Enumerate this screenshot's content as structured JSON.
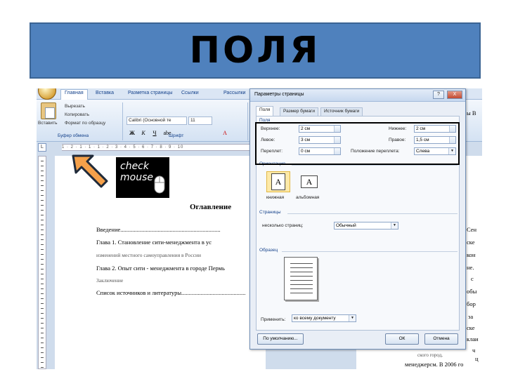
{
  "slide": {
    "title": "ПОЛЯ"
  },
  "word": {
    "ribbon_tabs": [
      "Главная",
      "Вставка",
      "Разметка страницы",
      "Ссылки",
      "Рассылки"
    ],
    "clipboard": {
      "paste_label": "Вставить",
      "cut": "Вырезать",
      "copy": "Копировать",
      "format_painter": "Формат по образцу",
      "group_label": "Буфер обмена"
    },
    "font": {
      "name": "Calibri (Основной те",
      "size": "11",
      "group_label": "Шрифт"
    },
    "ruler_text": "1 · 2 · 1 · 1 · 1 · 2 · 3 · 4 · 5 · 6 · 7 · 8 · 9 · 10",
    "ruler_tab_glyph": "L",
    "document": {
      "toc_title": "Оглавление",
      "lines": [
        "Введение...................................................................",
        "Глава 1. Становление сити-менеджмента в ус",
        "изменений местного самоуправления в России",
        "Глава 2. Опыт сити - менеджмента в городе Пермь",
        "Заключение",
        "Список источников и литературы..........................................."
      ],
      "right_fragments": [
        "ы В",
        "Сен",
        "ске",
        "кон",
        "не.",
        "с",
        "обы",
        "бор",
        "за",
        "ске",
        "кла",
        "ч",
        "ц",
        "и",
        "ского город,",
        "менеджерсм. В 2006 го"
      ]
    },
    "logo": {
      "line1": "check",
      "line2": "mouse"
    }
  },
  "dialog": {
    "title": "Параметры страницы",
    "title_buttons": {
      "help": "?",
      "close": "X"
    },
    "tabs": [
      "Поля",
      "Размер бумаги",
      "Источник бумаги"
    ],
    "margins_section": "Поля",
    "fields": {
      "top": {
        "label": "Верхнее:",
        "value": "2 см"
      },
      "bottom": {
        "label": "Нижнее:",
        "value": "2 см"
      },
      "left": {
        "label": "Левое:",
        "value": "3 см"
      },
      "right": {
        "label": "Правое:",
        "value": "1,5 см"
      },
      "gutter": {
        "label": "Переплет:",
        "value": "0 см"
      },
      "gutter_pos": {
        "label": "Положение переплета:",
        "value": "Слева"
      }
    },
    "orientation_section": "Ориентация",
    "orientation": {
      "portrait": "книжная",
      "landscape": "альбомная"
    },
    "pages_section": "Страницы",
    "pages": {
      "label": "несколько страниц:",
      "value": "Обычный"
    },
    "sample_section": "Образец",
    "apply": {
      "label": "Применить:",
      "value": "ко всему документу"
    },
    "buttons": {
      "default": "По умолчанию...",
      "ok": "ОК",
      "cancel": "Отмена"
    }
  },
  "colors": {
    "banner": "#4f81bd",
    "arrow": "#f4a04a",
    "dialog_bg": "#e9eef6"
  },
  "icons": [
    "paste-icon",
    "arrow-icon",
    "mouse-icon",
    "help-icon",
    "close-icon",
    "chevron-down-icon"
  ]
}
